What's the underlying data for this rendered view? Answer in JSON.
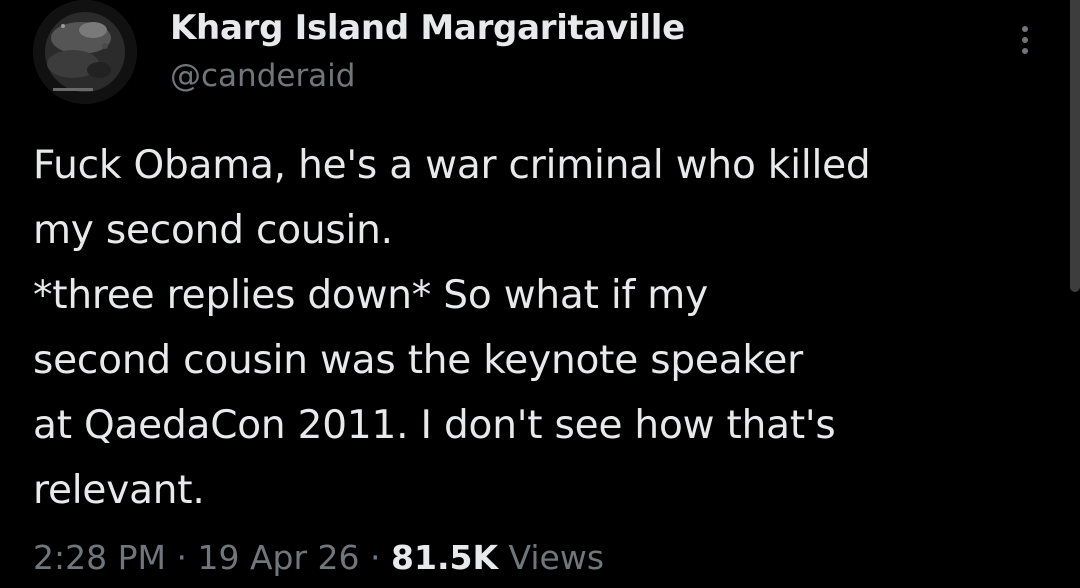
{
  "author": {
    "display_name": "Kharg Island Margaritaville",
    "handle": "@canderaid",
    "avatar_icon": "profile-avatar"
  },
  "tweet": {
    "text": "Fuck Obama, he's a war criminal who killed\nmy second cousin.\n*three replies down* So what if my\nsecond cousin was the keynote speaker\nat QaedaCon 2011. I don't see how that's\nrelevant."
  },
  "meta": {
    "time": "2:28 PM",
    "separator": "·",
    "date": "19 Apr 26",
    "views_count": "81.5K",
    "views_label": "Views"
  },
  "more_icon": "more-vertical-icon",
  "colors": {
    "background": "#000000",
    "primary_text": "#e7e9ea",
    "secondary_text": "#71767b"
  }
}
